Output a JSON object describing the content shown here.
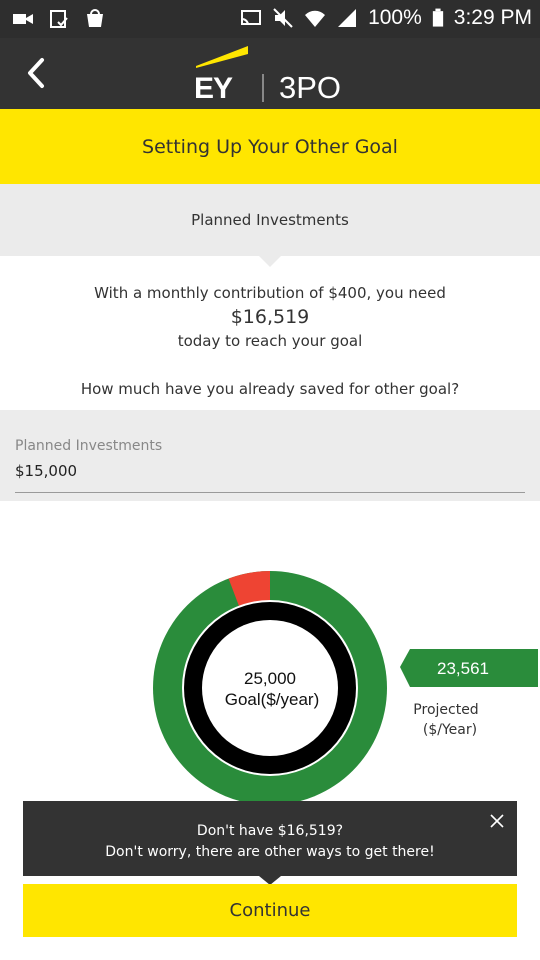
{
  "status_bar": {
    "battery": "100%",
    "time": "3:29 PM",
    "icons": [
      "video-icon",
      "screenshot-icon",
      "store-icon",
      "cast-icon",
      "mute-icon",
      "wifi-icon",
      "signal-icon",
      "battery-icon"
    ]
  },
  "app_bar": {
    "logo_text": "EY",
    "app_name": "3PO",
    "back_icon": "chevron-left-icon",
    "colors": {
      "background": "#333333",
      "logo_beam": "#ffe600"
    }
  },
  "title": "Setting Up Your Other Goal",
  "section_header": "Planned Investments",
  "info": {
    "line1": "With a monthly contribution of $400, you need",
    "amount": "$16,519",
    "line3": "today to reach your goal"
  },
  "question": "How much have you already saved for other goal?",
  "input": {
    "label": "Planned Investments",
    "value": "$15,000"
  },
  "gauge": {
    "goal_value": "25,000",
    "goal_label": "Goal($/year)",
    "projected_value": "23,561",
    "projected_label_line1": "Projected",
    "projected_label_line2": "($/Year)",
    "goal_number": 25000,
    "projected_number": 23561,
    "colors": {
      "projected": "#2a8c3b",
      "shortfall": "#ee4433",
      "inner_ring": "#000000"
    }
  },
  "toast": {
    "line1": "Don't have $16,519?",
    "line2": "Don't worry, there are other ways to get there!",
    "close_icon": "close-icon"
  },
  "continue_label": "Continue",
  "colors": {
    "accent": "#ffe600",
    "dark": "#333333",
    "light_gray": "#ebebeb"
  }
}
